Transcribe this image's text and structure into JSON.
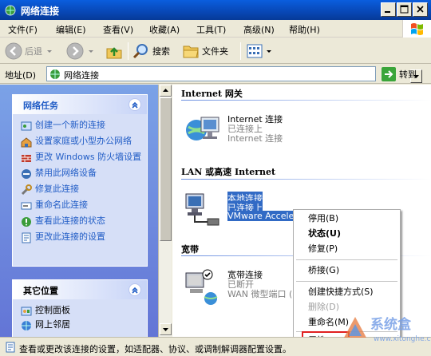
{
  "window": {
    "title": "网络连接"
  },
  "menu": [
    "文件(F)",
    "编辑(E)",
    "查看(V)",
    "收藏(A)",
    "工具(T)",
    "高级(N)",
    "帮助(H)"
  ],
  "toolbar": {
    "back": "后退",
    "search": "搜索",
    "folders": "文件夹"
  },
  "address": {
    "label": "地址(D)",
    "value": "网络连接",
    "go": "转到"
  },
  "network_tasks": {
    "title": "网络任务",
    "items": [
      "创建一个新的连接",
      "设置家庭或小型办公网络",
      "更改 Windows 防火墙设置",
      "禁用此网络设备",
      "修复此连接",
      "重命名此连接",
      "查看此连接的状态",
      "更改此连接的设置"
    ]
  },
  "other_places": {
    "title": "其它位置",
    "items": [
      "控制面板",
      "网上邻居"
    ]
  },
  "groups": {
    "internet_gateway": {
      "title": "Internet 网关",
      "name": "Internet 连接",
      "status": "已连接上",
      "detail": "Internet 连接"
    },
    "lan": {
      "title": "LAN 或高速 Internet",
      "name": "本地连接",
      "status": "已连接上",
      "detail": "VMware Acceler"
    },
    "broadband": {
      "title": "宽带",
      "name": "宽带连接",
      "status": "已断开",
      "detail": "WAN 微型端口 ("
    }
  },
  "context_menu": [
    {
      "label": "停用(B)",
      "style": "normal"
    },
    {
      "label": "状态(U)",
      "style": "bold"
    },
    {
      "label": "修复(P)",
      "style": "normal"
    },
    {
      "label": "桥接(G)",
      "style": "normal"
    },
    {
      "label": "创建快捷方式(S)",
      "style": "normal"
    },
    {
      "label": "删除(D)",
      "style": "disabled"
    },
    {
      "label": "重命名(M)",
      "style": "normal"
    },
    {
      "label": "属性(R)",
      "style": "normal"
    }
  ],
  "status_bar": "查看或更改该连接的设置，如适配器、协议、或调制解调器配置设置。",
  "watermark": {
    "text": "系统盒",
    "url": "www.xitonghe.com"
  },
  "colors": {
    "title_blue": "#0a5ede",
    "task_blue": "#215dc6",
    "selection": "#316ac5",
    "highlight_box": "#e02020"
  }
}
